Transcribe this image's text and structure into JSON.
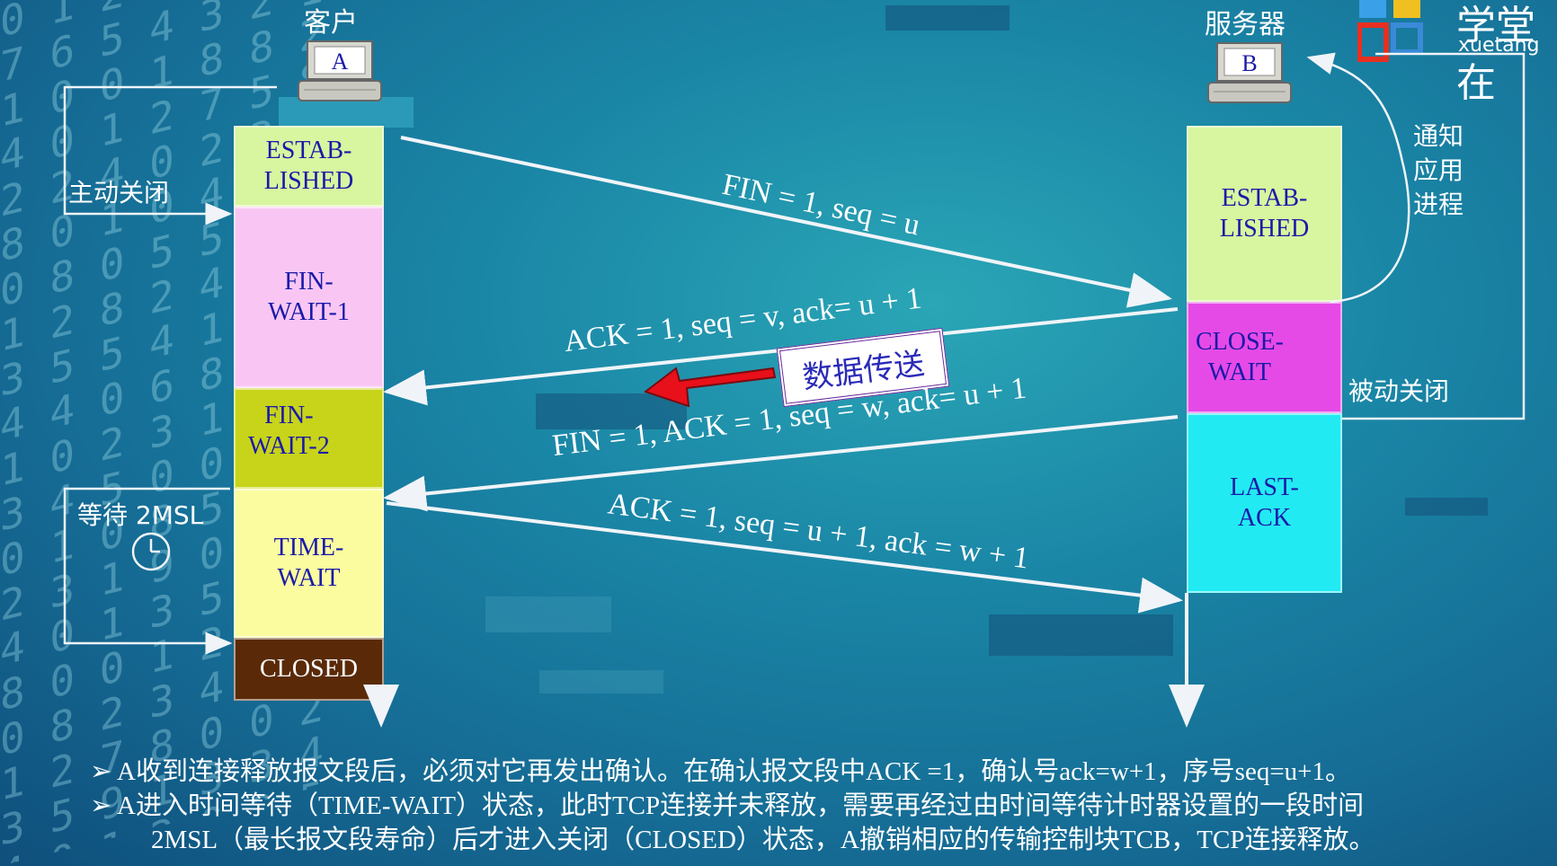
{
  "client": {
    "title": "客户",
    "computer_letter": "A"
  },
  "server": {
    "title": "服务器",
    "computer_letter": "B"
  },
  "logo": {
    "cn": "学堂在",
    "en": "xuetang"
  },
  "client_states": [
    {
      "label": "ESTAB-\nLISHED",
      "color": "#d8f5a0"
    },
    {
      "label": "FIN-\nWAIT-1",
      "color": "#f9c6f4"
    },
    {
      "label": "FIN-\nWAIT-2",
      "color": "#c8d41a"
    },
    {
      "label": "TIME-\nWAIT",
      "color": "#fbfca0"
    },
    {
      "label": "CLOSED",
      "color": "#5a2a08",
      "text_color": "#ffffff"
    }
  ],
  "server_states": [
    {
      "label": "ESTAB-\nLISHED",
      "color": "#d8f5a0"
    },
    {
      "label": "CLOSE-\nWAIT",
      "color": "#e64ae6"
    },
    {
      "label": "LAST-\nACK",
      "color": "#22eaf2"
    }
  ],
  "labels": {
    "active_close": "主动关闭",
    "wait_2msl": "等待 2MSL",
    "notify": [
      "通知",
      "应用",
      "进程"
    ],
    "passive_close": "被动关闭",
    "data_transfer": "数据传送"
  },
  "messages": [
    "FIN = 1, seq = u",
    "ACK = 1, seq = v, ack= u + 1",
    "FIN = 1, ACK = 1, seq = w, ack= u + 1",
    "ACK = 1, seq = u + 1, ack = w + 1"
  ],
  "bullets": [
    "A收到连接释放报文段后，必须对它再发出确认。在确认报文段中ACK =1，确认号ack=w+1，序号seq=u+1。",
    "A进入时间等待（TIME-WAIT）状态，此时TCP连接并未释放，需要再经过由时间等待计时器设置的一段时间",
    "2MSL（最长报文段寿命）后才进入关闭（CLOSED）状态，A撤销相应的传输控制块TCB，TCP连接释放。"
  ],
  "colors": {
    "arrow_red": "#e8101a",
    "text_blue": "#1a1aa8"
  }
}
